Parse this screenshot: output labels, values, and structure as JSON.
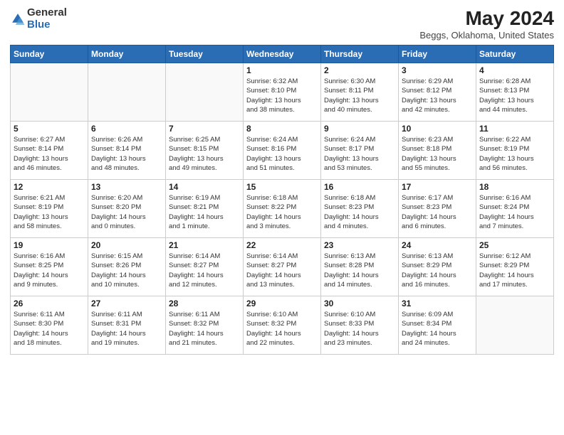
{
  "header": {
    "logo_general": "General",
    "logo_blue": "Blue",
    "title": "May 2024",
    "subtitle": "Beggs, Oklahoma, United States"
  },
  "days_of_week": [
    "Sunday",
    "Monday",
    "Tuesday",
    "Wednesday",
    "Thursday",
    "Friday",
    "Saturday"
  ],
  "weeks": [
    [
      {
        "day": "",
        "info": ""
      },
      {
        "day": "",
        "info": ""
      },
      {
        "day": "",
        "info": ""
      },
      {
        "day": "1",
        "info": "Sunrise: 6:32 AM\nSunset: 8:10 PM\nDaylight: 13 hours\nand 38 minutes."
      },
      {
        "day": "2",
        "info": "Sunrise: 6:30 AM\nSunset: 8:11 PM\nDaylight: 13 hours\nand 40 minutes."
      },
      {
        "day": "3",
        "info": "Sunrise: 6:29 AM\nSunset: 8:12 PM\nDaylight: 13 hours\nand 42 minutes."
      },
      {
        "day": "4",
        "info": "Sunrise: 6:28 AM\nSunset: 8:13 PM\nDaylight: 13 hours\nand 44 minutes."
      }
    ],
    [
      {
        "day": "5",
        "info": "Sunrise: 6:27 AM\nSunset: 8:14 PM\nDaylight: 13 hours\nand 46 minutes."
      },
      {
        "day": "6",
        "info": "Sunrise: 6:26 AM\nSunset: 8:14 PM\nDaylight: 13 hours\nand 48 minutes."
      },
      {
        "day": "7",
        "info": "Sunrise: 6:25 AM\nSunset: 8:15 PM\nDaylight: 13 hours\nand 49 minutes."
      },
      {
        "day": "8",
        "info": "Sunrise: 6:24 AM\nSunset: 8:16 PM\nDaylight: 13 hours\nand 51 minutes."
      },
      {
        "day": "9",
        "info": "Sunrise: 6:24 AM\nSunset: 8:17 PM\nDaylight: 13 hours\nand 53 minutes."
      },
      {
        "day": "10",
        "info": "Sunrise: 6:23 AM\nSunset: 8:18 PM\nDaylight: 13 hours\nand 55 minutes."
      },
      {
        "day": "11",
        "info": "Sunrise: 6:22 AM\nSunset: 8:19 PM\nDaylight: 13 hours\nand 56 minutes."
      }
    ],
    [
      {
        "day": "12",
        "info": "Sunrise: 6:21 AM\nSunset: 8:19 PM\nDaylight: 13 hours\nand 58 minutes."
      },
      {
        "day": "13",
        "info": "Sunrise: 6:20 AM\nSunset: 8:20 PM\nDaylight: 14 hours\nand 0 minutes."
      },
      {
        "day": "14",
        "info": "Sunrise: 6:19 AM\nSunset: 8:21 PM\nDaylight: 14 hours\nand 1 minute."
      },
      {
        "day": "15",
        "info": "Sunrise: 6:18 AM\nSunset: 8:22 PM\nDaylight: 14 hours\nand 3 minutes."
      },
      {
        "day": "16",
        "info": "Sunrise: 6:18 AM\nSunset: 8:23 PM\nDaylight: 14 hours\nand 4 minutes."
      },
      {
        "day": "17",
        "info": "Sunrise: 6:17 AM\nSunset: 8:23 PM\nDaylight: 14 hours\nand 6 minutes."
      },
      {
        "day": "18",
        "info": "Sunrise: 6:16 AM\nSunset: 8:24 PM\nDaylight: 14 hours\nand 7 minutes."
      }
    ],
    [
      {
        "day": "19",
        "info": "Sunrise: 6:16 AM\nSunset: 8:25 PM\nDaylight: 14 hours\nand 9 minutes."
      },
      {
        "day": "20",
        "info": "Sunrise: 6:15 AM\nSunset: 8:26 PM\nDaylight: 14 hours\nand 10 minutes."
      },
      {
        "day": "21",
        "info": "Sunrise: 6:14 AM\nSunset: 8:27 PM\nDaylight: 14 hours\nand 12 minutes."
      },
      {
        "day": "22",
        "info": "Sunrise: 6:14 AM\nSunset: 8:27 PM\nDaylight: 14 hours\nand 13 minutes."
      },
      {
        "day": "23",
        "info": "Sunrise: 6:13 AM\nSunset: 8:28 PM\nDaylight: 14 hours\nand 14 minutes."
      },
      {
        "day": "24",
        "info": "Sunrise: 6:13 AM\nSunset: 8:29 PM\nDaylight: 14 hours\nand 16 minutes."
      },
      {
        "day": "25",
        "info": "Sunrise: 6:12 AM\nSunset: 8:29 PM\nDaylight: 14 hours\nand 17 minutes."
      }
    ],
    [
      {
        "day": "26",
        "info": "Sunrise: 6:11 AM\nSunset: 8:30 PM\nDaylight: 14 hours\nand 18 minutes."
      },
      {
        "day": "27",
        "info": "Sunrise: 6:11 AM\nSunset: 8:31 PM\nDaylight: 14 hours\nand 19 minutes."
      },
      {
        "day": "28",
        "info": "Sunrise: 6:11 AM\nSunset: 8:32 PM\nDaylight: 14 hours\nand 21 minutes."
      },
      {
        "day": "29",
        "info": "Sunrise: 6:10 AM\nSunset: 8:32 PM\nDaylight: 14 hours\nand 22 minutes."
      },
      {
        "day": "30",
        "info": "Sunrise: 6:10 AM\nSunset: 8:33 PM\nDaylight: 14 hours\nand 23 minutes."
      },
      {
        "day": "31",
        "info": "Sunrise: 6:09 AM\nSunset: 8:34 PM\nDaylight: 14 hours\nand 24 minutes."
      },
      {
        "day": "",
        "info": ""
      }
    ]
  ]
}
